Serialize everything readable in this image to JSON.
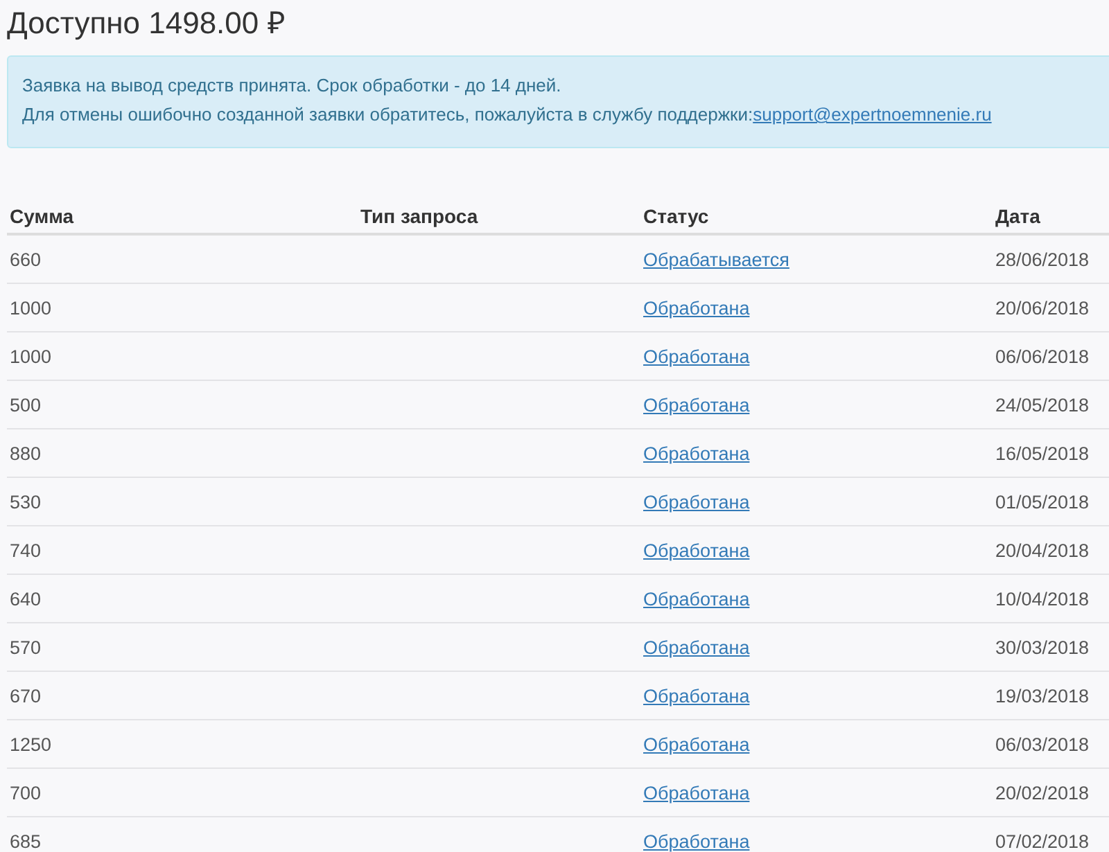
{
  "balance": "Доступно 1498.00 ₽",
  "alert": {
    "line1": "Заявка на вывод средств принята. Срок обработки - до 14 дней.",
    "line2": "Для отмены ошибочно созданной заявки обратитесь, пожалуйста в службу поддержки:",
    "link": "support@expertnoemnenie.ru"
  },
  "table": {
    "columns": [
      "Сумма",
      "Тип запроса",
      "Статус",
      "Дата"
    ],
    "rows": [
      {
        "amount": "660",
        "status": "Обрабатывается",
        "date": "28/06/2018"
      },
      {
        "amount": "1000",
        "status": "Обработана",
        "date": "20/06/2018"
      },
      {
        "amount": "1000",
        "status": "Обработана",
        "date": "06/06/2018"
      },
      {
        "amount": "500",
        "status": "Обработана",
        "date": "24/05/2018"
      },
      {
        "amount": "880",
        "status": "Обработана",
        "date": "16/05/2018"
      },
      {
        "amount": "530",
        "status": "Обработана",
        "date": "01/05/2018"
      },
      {
        "amount": "740",
        "status": "Обработана",
        "date": "20/04/2018"
      },
      {
        "amount": "640",
        "status": "Обработана",
        "date": "10/04/2018"
      },
      {
        "amount": "570",
        "status": "Обработана",
        "date": "30/03/2018"
      },
      {
        "amount": "670",
        "status": "Обработана",
        "date": "19/03/2018"
      },
      {
        "amount": "1250",
        "status": "Обработана",
        "date": "06/03/2018"
      },
      {
        "amount": "700",
        "status": "Обработана",
        "date": "20/02/2018"
      },
      {
        "amount": "685",
        "status": "Обработана",
        "date": "07/02/2018"
      }
    ]
  }
}
